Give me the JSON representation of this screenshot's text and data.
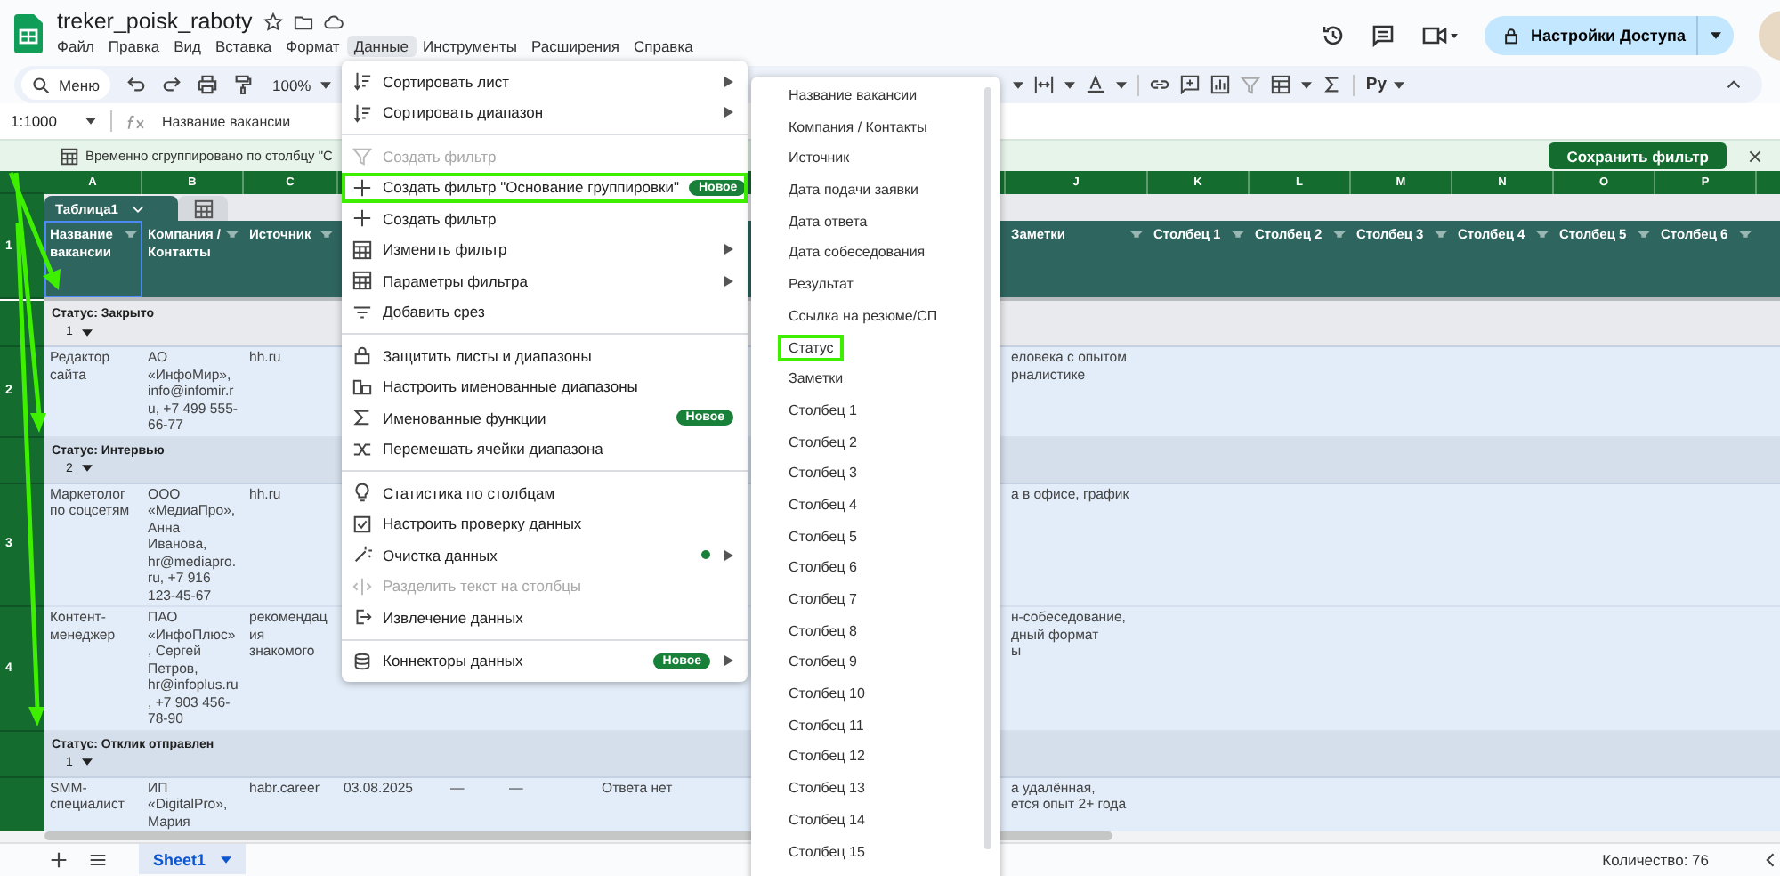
{
  "app": {
    "title": "treker_poisk_raboty",
    "share_button": "Настройки Доступа",
    "menus": [
      {
        "label": "Файл",
        "selected": false
      },
      {
        "label": "Правка",
        "selected": false
      },
      {
        "label": "Вид",
        "selected": false
      },
      {
        "label": "Вставка",
        "selected": false
      },
      {
        "label": "Формат",
        "selected": false
      },
      {
        "label": "Данные",
        "selected": true
      },
      {
        "label": "Инструменты",
        "selected": false
      },
      {
        "label": "Расширения",
        "selected": false
      },
      {
        "label": "Справка",
        "selected": false
      }
    ]
  },
  "toolbar": {
    "search": {
      "placeholder": "Меню"
    },
    "zoom": "100%",
    "input_tools": "Ру"
  },
  "formula_bar": {
    "range": "1:1000",
    "value": "Название вакансии"
  },
  "banner": {
    "text": "Временно сгруппировано по столбцу \"С",
    "save_button": "Сохранить фильтр"
  },
  "sheet": {
    "columns_left": [
      "A",
      "B",
      "C"
    ],
    "columns_right": [
      "J",
      "K",
      "L",
      "M",
      "N",
      "O",
      "P"
    ],
    "table_name": "Таблица1",
    "header_row_number": "1",
    "header_left": [
      "Название вакансии",
      "Компания / Контакты",
      "Источник"
    ],
    "header_right": [
      "Заметки",
      "Столбец 1",
      "Столбец 2",
      "Столбец 3",
      "Столбец 4",
      "Столбец 5",
      "Столбец 6"
    ],
    "rows": [
      {
        "kind": "group",
        "label": "Статус: Закрыто",
        "count": "1"
      },
      {
        "kind": "data",
        "number": "2",
        "cells": [
          "Редактор сайта",
          "АО «ИнфоМир», info@infomir.ru, +7 499 555-66-77",
          "hh.ru",
          null,
          null,
          null,
          null,
          null,
          null,
          "еловека с опытом\nрналистике",
          null,
          null,
          null,
          null,
          null,
          null
        ]
      },
      {
        "kind": "group",
        "label": "Статус: Интервью",
        "count": "2"
      },
      {
        "kind": "data",
        "number": "3",
        "cells": [
          "Маркетолог по соцсетям",
          "ООО «МедиаПро», Анна Иванова, hr@mediapro.ru, +7 916 123-45-67",
          "hh.ru",
          null,
          null,
          null,
          null,
          null,
          null,
          "а в офисе, график",
          null,
          null,
          null,
          null,
          null,
          null
        ]
      },
      {
        "kind": "data",
        "number": "4",
        "cells": [
          "Контент-менеджер",
          "ПАО «ИнфоПлюс», Сергей Петров, hr@infoplus.ru, +7 903 456-78-90",
          "рекомендация знакомого",
          null,
          null,
          null,
          null,
          null,
          null,
          "н-собеседование,\nдный формат\nы",
          null,
          null,
          null,
          null,
          null,
          null
        ]
      },
      {
        "kind": "group",
        "label": "Статус: Отклик отправлен",
        "count": "1"
      },
      {
        "kind": "data",
        "cells": [
          "SMM-специалист",
          "ИП «DigitalPro», Мария",
          "habr.career",
          "03.08.2025",
          "—",
          "—",
          "Ответа нет",
          null,
          null,
          "а удалённая,\nется опыт 2+ года",
          null,
          null,
          null,
          null,
          null,
          null
        ]
      }
    ]
  },
  "data_menu": {
    "sections": [
      {
        "items": [
          {
            "label": "Сортировать лист",
            "disabled": false,
            "highlighted": false,
            "submenu": true,
            "dot": false
          },
          {
            "label": "Сортировать диапазон",
            "disabled": false,
            "highlighted": false,
            "submenu": true,
            "dot": false
          }
        ]
      },
      {
        "items": [
          {
            "label": "Создать фильтр",
            "disabled": true,
            "highlighted": false,
            "submenu": false,
            "dot": false
          },
          {
            "label": "Создать фильтр \"Основание группировки\"",
            "disabled": false,
            "highlighted": true,
            "submenu": true,
            "dot": false,
            "badge": "Новое"
          },
          {
            "label": "Создать фильтр",
            "disabled": false,
            "highlighted": false,
            "submenu": false,
            "dot": false
          },
          {
            "label": "Изменить фильтр",
            "disabled": false,
            "highlighted": false,
            "submenu": true,
            "dot": false
          },
          {
            "label": "Параметры фильтра",
            "disabled": false,
            "highlighted": false,
            "submenu": true,
            "dot": false
          },
          {
            "label": "Добавить срез",
            "disabled": false,
            "highlighted": false,
            "submenu": false,
            "dot": false
          }
        ]
      },
      {
        "items": [
          {
            "label": "Защитить листы и диапазоны",
            "disabled": false,
            "highlighted": false,
            "submenu": false,
            "dot": false
          },
          {
            "label": "Настроить именованные диапазоны",
            "disabled": false,
            "highlighted": false,
            "submenu": false,
            "dot": false
          },
          {
            "label": "Именованные функции",
            "disabled": false,
            "highlighted": false,
            "submenu": false,
            "dot": false,
            "badge": "Новое"
          },
          {
            "label": "Перемешать ячейки диапазона",
            "disabled": false,
            "highlighted": false,
            "submenu": false,
            "dot": false
          }
        ]
      },
      {
        "items": [
          {
            "label": "Статистика по столбцам",
            "disabled": false,
            "highlighted": false,
            "submenu": false,
            "dot": false
          },
          {
            "label": "Настроить проверку данных",
            "disabled": false,
            "highlighted": false,
            "submenu": false,
            "dot": false
          },
          {
            "label": "Очистка данных",
            "disabled": false,
            "highlighted": false,
            "submenu": true,
            "dot": true
          },
          {
            "label": "Разделить текст на столбцы",
            "disabled": true,
            "highlighted": false,
            "submenu": false,
            "dot": false
          },
          {
            "label": "Извлечение данных",
            "disabled": false,
            "highlighted": false,
            "submenu": false,
            "dot": false
          }
        ]
      },
      {
        "items": [
          {
            "label": "Коннекторы данных",
            "disabled": false,
            "highlighted": false,
            "submenu": true,
            "dot": false,
            "badge": "Новое"
          }
        ]
      }
    ]
  },
  "submenu": {
    "items": [
      {
        "label": "Название вакансии",
        "highlighted": false
      },
      {
        "label": "Компания / Контакты",
        "highlighted": false
      },
      {
        "label": "Источник",
        "highlighted": false
      },
      {
        "label": "Дата подачи заявки",
        "highlighted": false
      },
      {
        "label": "Дата ответа",
        "highlighted": false
      },
      {
        "label": "Дата собеседования",
        "highlighted": false
      },
      {
        "label": "Результат",
        "highlighted": false
      },
      {
        "label": "Ссылка на резюме/СП",
        "highlighted": false
      },
      {
        "label": "Статус",
        "highlighted": true
      },
      {
        "label": "Заметки",
        "highlighted": false
      },
      {
        "label": "Столбец 1",
        "highlighted": false
      },
      {
        "label": "Столбец 2",
        "highlighted": false
      },
      {
        "label": "Столбец 3",
        "highlighted": false
      },
      {
        "label": "Столбец 4",
        "highlighted": false
      },
      {
        "label": "Столбец 5",
        "highlighted": false
      },
      {
        "label": "Столбец 6",
        "highlighted": false
      },
      {
        "label": "Столбец 7",
        "highlighted": false
      },
      {
        "label": "Столбец 8",
        "highlighted": false
      },
      {
        "label": "Столбец 9",
        "highlighted": false
      },
      {
        "label": "Столбец 10",
        "highlighted": false
      },
      {
        "label": "Столбец 11",
        "highlighted": false
      },
      {
        "label": "Столбец 12",
        "highlighted": false
      },
      {
        "label": "Столбец 13",
        "highlighted": false
      },
      {
        "label": "Столбец 14",
        "highlighted": false
      },
      {
        "label": "Столбец 15",
        "highlighted": false
      }
    ]
  },
  "bottom_bar": {
    "tabs": [
      {
        "label": "Sheet1",
        "selected": true
      }
    ],
    "summary": "Количество: 76"
  }
}
